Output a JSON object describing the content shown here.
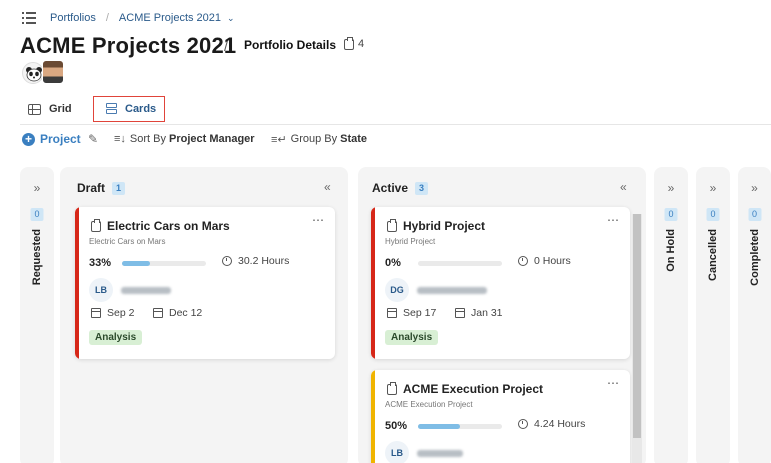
{
  "breadcrumb": {
    "root": "Portfolios",
    "current": "ACME Projects 2021"
  },
  "header": {
    "title": "ACME Projects 2021",
    "subtitle": "Portfolio Details",
    "project_count": "4"
  },
  "views": {
    "grid_label": "Grid",
    "cards_label": "Cards",
    "active": "Cards"
  },
  "toolbar": {
    "add_label": "Project",
    "sort_prefix": "Sort By",
    "sort_value": "Project Manager",
    "group_prefix": "Group By",
    "group_value": "State"
  },
  "columns": {
    "requested": {
      "label": "Requested",
      "count": "0"
    },
    "draft": {
      "label": "Draft",
      "count": "1"
    },
    "active": {
      "label": "Active",
      "count": "3"
    },
    "on_hold": {
      "label": "On Hold",
      "count": "0"
    },
    "cancelled": {
      "label": "Cancelled",
      "count": "0"
    },
    "completed": {
      "label": "Completed",
      "count": "0"
    }
  },
  "cards": {
    "electric": {
      "name": "Electric Cars on Mars",
      "desc": "Electric Cars on Mars",
      "progress": "33%",
      "progress_fraction": 0.33,
      "hours": "30.2 Hours",
      "initials": "LB",
      "start": "Sep 2",
      "end": "Dec 12",
      "tag": "Analysis",
      "stripe_color": "#d62718"
    },
    "hybrid": {
      "name": "Hybrid Project",
      "desc": "Hybrid Project",
      "progress": "0%",
      "progress_fraction": 0.0,
      "hours": "0 Hours",
      "initials": "DG",
      "start": "Sep 17",
      "end": "Jan 31",
      "tag": "Analysis",
      "stripe_color": "#d62718"
    },
    "acme": {
      "name": "ACME Execution Project",
      "desc": "ACME Execution Project",
      "progress": "50%",
      "progress_fraction": 0.5,
      "hours": "4.24 Hours",
      "initials": "LB",
      "stripe_color": "#f0b400"
    }
  },
  "colors": {
    "accent": "#3a7fc0",
    "highlight_border": "#e0443a",
    "badge_bg": "#cfe6f6",
    "tag_bg": "#d8efd4"
  }
}
